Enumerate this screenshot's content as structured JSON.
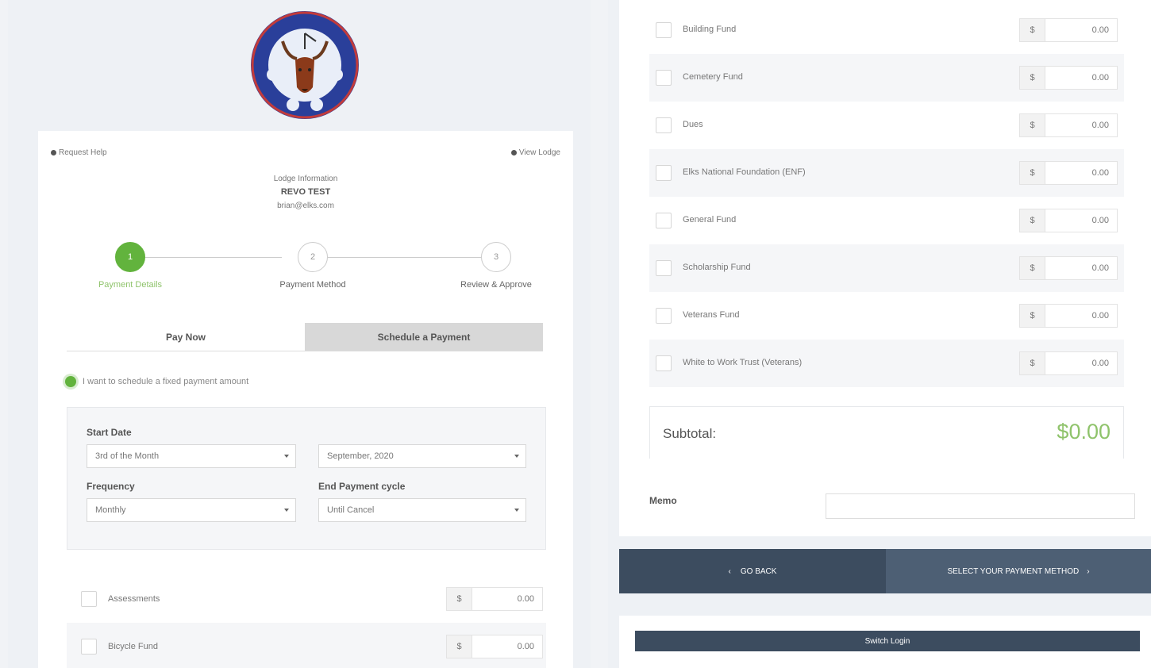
{
  "header": {
    "left_link": "Request Help",
    "right_link": "View Lodge"
  },
  "lodge": {
    "caption": "Lodge Information",
    "name": "REVO TEST",
    "email": "brian@elks.com"
  },
  "steps": [
    {
      "number": "1",
      "label": "Payment Details"
    },
    {
      "number": "2",
      "label": "Payment Method"
    },
    {
      "number": "3",
      "label": "Review & Approve"
    }
  ],
  "tabs": {
    "pay_now": "Pay Now",
    "schedule": "Schedule a Payment"
  },
  "schedule_option": "I want to schedule a fixed payment amount",
  "schedule": {
    "start_date_label": "Start Date",
    "start_day_value": "3rd of the Month",
    "start_month_value": "September, 2020",
    "frequency_label": "Frequency",
    "frequency_value": "Monthly",
    "end_cycle_label": "End Payment cycle",
    "end_cycle_value": "Until Cancel"
  },
  "left_funds": [
    {
      "name": "Assessments",
      "currency": "$",
      "amount": "0.00"
    },
    {
      "name": "Bicycle Fund",
      "currency": "$",
      "amount": "0.00"
    }
  ],
  "right_funds": [
    {
      "name": "Building Fund",
      "currency": "$",
      "amount": "0.00"
    },
    {
      "name": "Cemetery Fund",
      "currency": "$",
      "amount": "0.00"
    },
    {
      "name": "Dues",
      "currency": "$",
      "amount": "0.00"
    },
    {
      "name": "Elks National Foundation (ENF)",
      "currency": "$",
      "amount": "0.00"
    },
    {
      "name": "General Fund",
      "currency": "$",
      "amount": "0.00"
    },
    {
      "name": "Scholarship Fund",
      "currency": "$",
      "amount": "0.00"
    },
    {
      "name": "Veterans Fund",
      "currency": "$",
      "amount": "0.00"
    },
    {
      "name": "White to Work Trust (Veterans)",
      "currency": "$",
      "amount": "0.00"
    }
  ],
  "subtotal": {
    "label": "Subtotal:",
    "value": "$0.00"
  },
  "memo": {
    "label": "Memo",
    "placeholder": ""
  },
  "footer": {
    "go_back": "GO BACK",
    "select_method": "SELECT YOUR PAYMENT METHOD",
    "bottom_button": "Switch Login"
  },
  "colors": {
    "accent_green": "#62b33d",
    "subtotal_green": "#8fc36b",
    "navy": "#3c4c5f"
  }
}
